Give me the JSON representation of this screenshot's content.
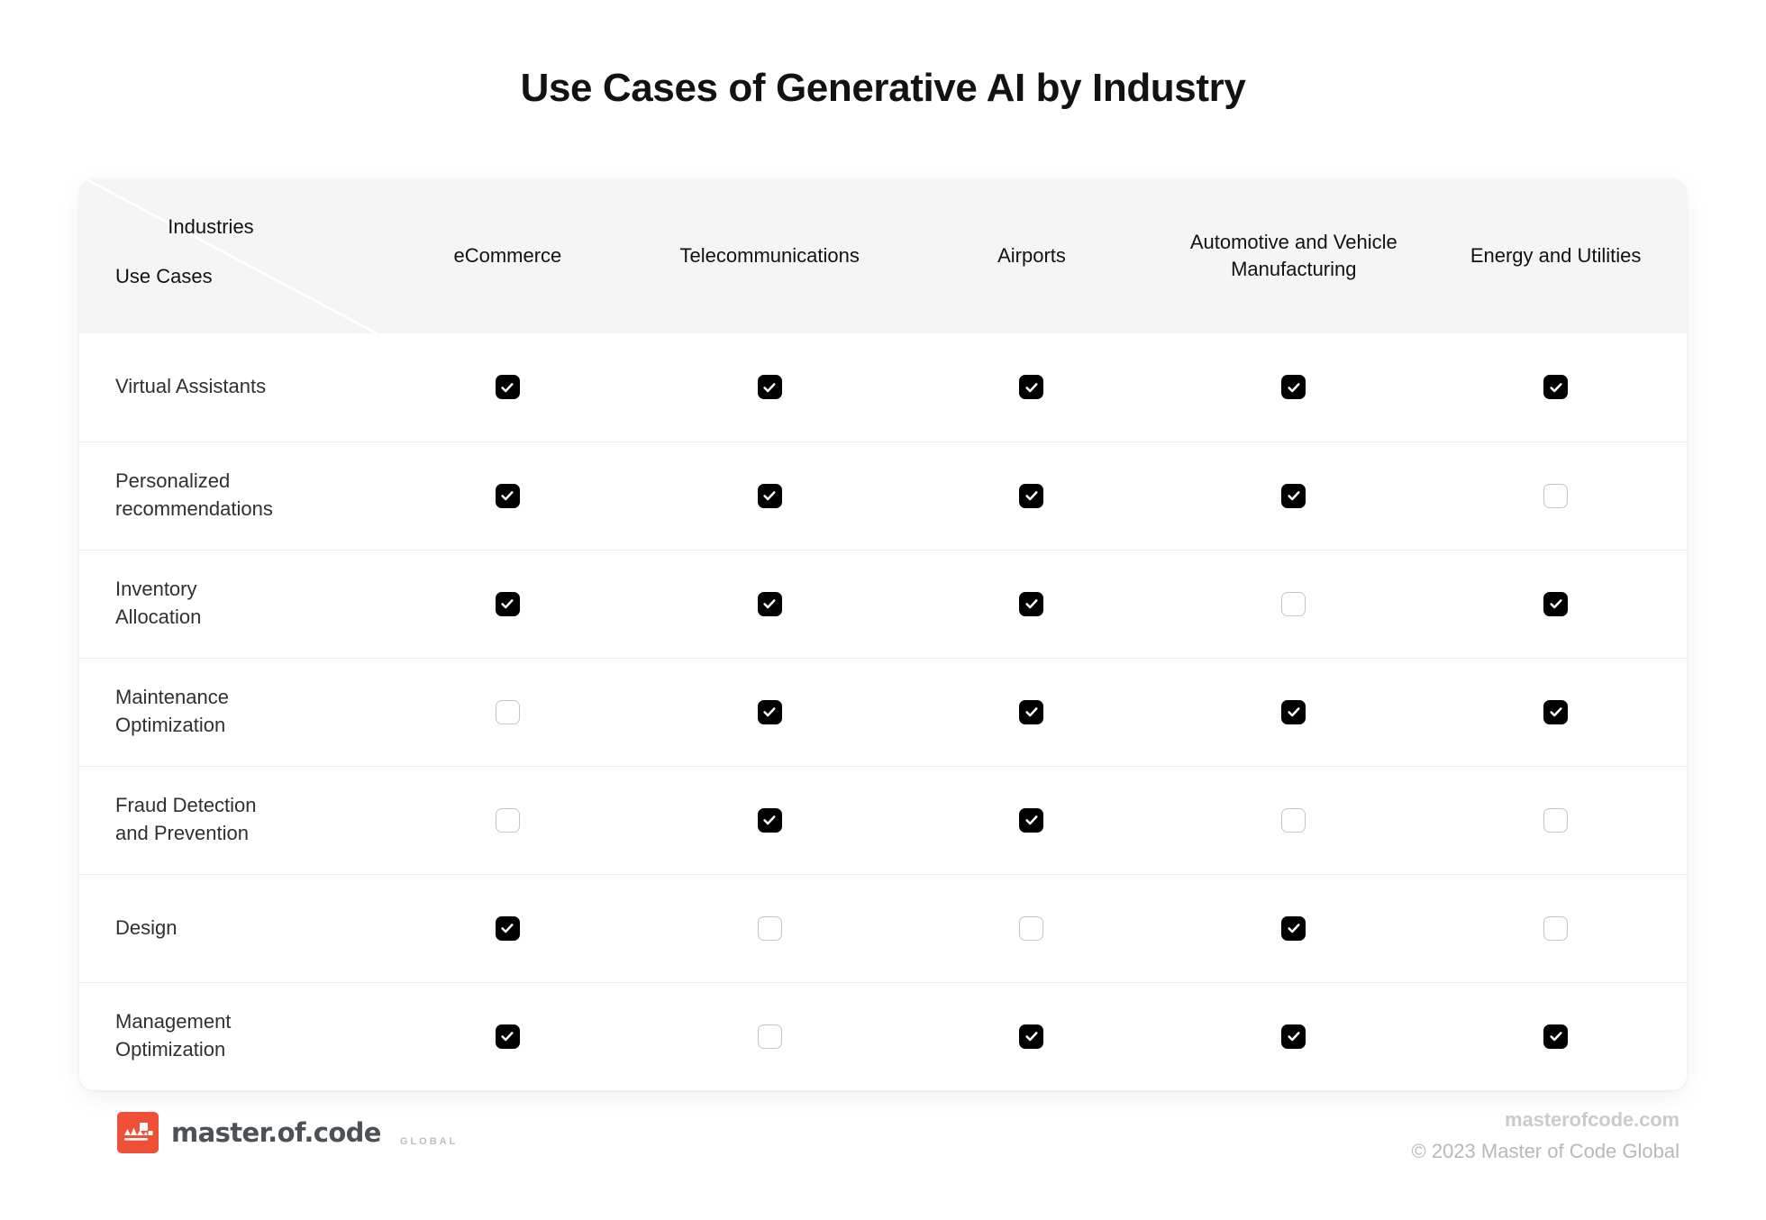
{
  "page": {
    "title": "Use Cases of Generative AI by Industry",
    "background_color": "#ffffff",
    "accent_color": "#ef5138",
    "checked_color": "#000000"
  },
  "table": {
    "corner": {
      "industries_label": "Industries",
      "usecases_label": "Use Cases"
    },
    "columns": [
      "eCommerce",
      "Telecommunications",
      "Airports",
      "Automotive and Vehicle Manufacturing",
      "Energy and Utilities"
    ],
    "rows": [
      {
        "label": "Virtual Assistants",
        "label_lines": [
          "Virtual Assistants"
        ],
        "values": [
          true,
          true,
          true,
          true,
          true
        ]
      },
      {
        "label": "Personalized recommendations",
        "label_lines": [
          "Personalized",
          "recommendations"
        ],
        "values": [
          true,
          true,
          true,
          true,
          false
        ]
      },
      {
        "label": "Inventory Allocation",
        "label_lines": [
          "Inventory",
          "Allocation"
        ],
        "values": [
          true,
          true,
          true,
          false,
          true
        ]
      },
      {
        "label": "Maintenance Optimization",
        "label_lines": [
          "Maintenance",
          "Optimization"
        ],
        "values": [
          false,
          true,
          true,
          true,
          true
        ]
      },
      {
        "label": "Fraud Detection and Prevention",
        "label_lines": [
          "Fraud Detection",
          "and Prevention"
        ],
        "values": [
          false,
          true,
          true,
          false,
          false
        ]
      },
      {
        "label": "Design",
        "label_lines": [
          "Design"
        ],
        "values": [
          true,
          false,
          false,
          true,
          false
        ]
      },
      {
        "label": "Management Optimization",
        "label_lines": [
          "Management",
          "Optimization"
        ],
        "values": [
          true,
          false,
          true,
          true,
          true
        ]
      }
    ]
  },
  "footer": {
    "logo_text": "master.of.code",
    "logo_sub": "GLOBAL",
    "site": "masterofcode.com",
    "copyright": "© 2023 Master of Code Global"
  },
  "chart_data": {
    "type": "table",
    "title": "Use Cases of Generative AI by Industry",
    "row_axis_label": "Use Cases",
    "column_axis_label": "Industries",
    "categories": [
      "eCommerce",
      "Telecommunications",
      "Airports",
      "Automotive and Vehicle Manufacturing",
      "Energy and Utilities"
    ],
    "rows": [
      "Virtual Assistants",
      "Personalized recommendations",
      "Inventory Allocation",
      "Maintenance Optimization",
      "Fraud Detection and Prevention",
      "Design",
      "Management Optimization"
    ],
    "values": [
      [
        1,
        1,
        1,
        1,
        1
      ],
      [
        1,
        1,
        1,
        1,
        0
      ],
      [
        1,
        1,
        1,
        0,
        1
      ],
      [
        0,
        1,
        1,
        1,
        1
      ],
      [
        0,
        1,
        1,
        0,
        0
      ],
      [
        1,
        0,
        0,
        1,
        0
      ],
      [
        1,
        0,
        1,
        1,
        1
      ]
    ],
    "value_legend": {
      "1": "checked",
      "0": "unchecked"
    }
  }
}
